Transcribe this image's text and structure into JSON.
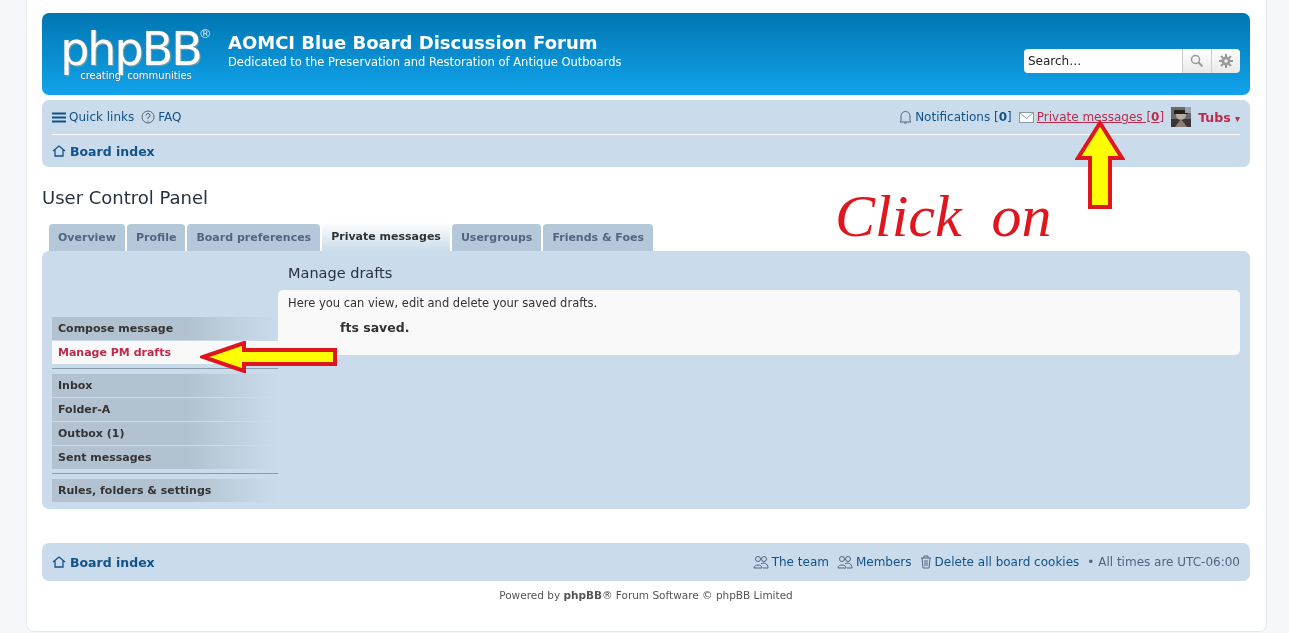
{
  "header": {
    "logo": {
      "word": "phpBB",
      "mark": "®",
      "tagline_left": "creating",
      "tagline_right": "communities"
    },
    "title": "AOMCI Blue Board Discussion Forum",
    "subtitle": "Dedicated to the Preservation and Restoration of Antique Outboards",
    "search": {
      "placeholder": "Search…"
    }
  },
  "navbar": {
    "quick_links": "Quick links",
    "faq": "FAQ",
    "notifications": "Notifications [**0**]",
    "private_messages": "Private messages [**0**]",
    "user": {
      "name": "Tubs",
      "caret": "▾"
    },
    "breadcrumb": "Board index"
  },
  "page_title": "User Control Panel",
  "tabs": [
    {
      "label": "Overview",
      "selected": false
    },
    {
      "label": "Profile",
      "selected": false
    },
    {
      "label": "Board preferences",
      "selected": false
    },
    {
      "label": "Private messages",
      "selected": true
    },
    {
      "label": "Usergroups",
      "selected": false
    },
    {
      "label": "Friends & Foes",
      "selected": false
    }
  ],
  "menu": [
    {
      "items": [
        {
          "label": "Compose message",
          "selected": false
        },
        {
          "label": "Manage PM drafts",
          "selected": true
        }
      ]
    },
    {
      "items": [
        {
          "label": "Inbox",
          "selected": false
        },
        {
          "label": "Folder-A",
          "selected": false
        },
        {
          "label": "Outbox (1)",
          "selected": false
        },
        {
          "label": "Sent messages",
          "selected": false
        }
      ]
    },
    {
      "items": [
        {
          "label": "Rules, folders & settings",
          "selected": false
        }
      ]
    }
  ],
  "content": {
    "heading": "Manage drafts",
    "intro": "Here you can view, edit and delete your saved drafts.",
    "status": "fts saved."
  },
  "annotation": {
    "text": "Click  on"
  },
  "footer": {
    "breadcrumb": "Board index",
    "links": [
      {
        "kind": "team",
        "label": "The team"
      },
      {
        "kind": "members",
        "label": "Members"
      },
      {
        "kind": "cookies",
        "label": "Delete all board cookies"
      }
    ],
    "timezone": "• All times are UTC-06:00",
    "copyright": "Powered by **phpBB**® Forum Software © phpBB Limited"
  }
}
